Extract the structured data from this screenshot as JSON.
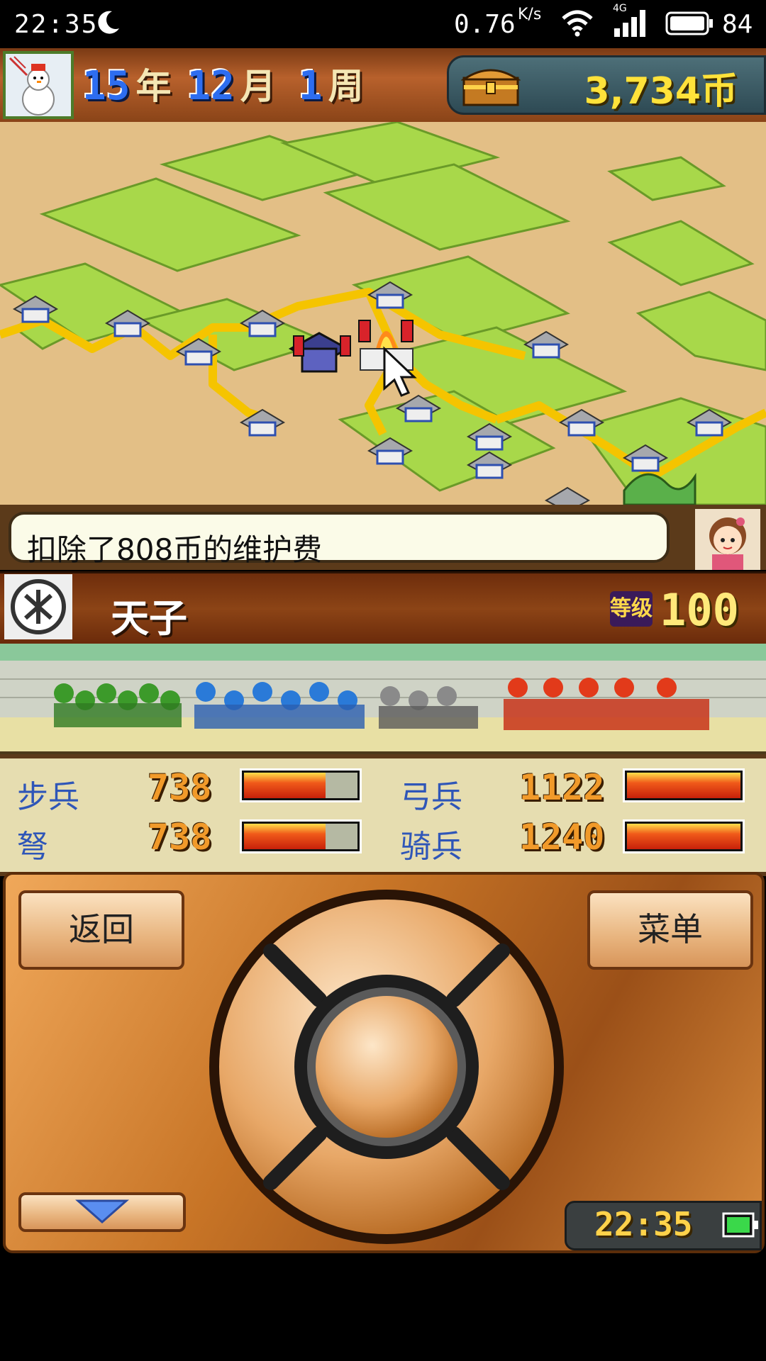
{
  "status_bar": {
    "time": "22:35",
    "speed": "0.76",
    "speed_unit": "K/s",
    "network": "4G",
    "battery": "84"
  },
  "header": {
    "year": "15",
    "year_unit": "年",
    "month": "12",
    "month_unit": "月",
    "week": "1",
    "week_unit": "周",
    "money": "3,734币"
  },
  "message": {
    "text": "扣除了808币的维护费"
  },
  "player": {
    "name": "天子",
    "level_label": "等级",
    "level": "100"
  },
  "stats": [
    {
      "label": "步兵",
      "value": "738",
      "fill": 0.72
    },
    {
      "label": "弓兵",
      "value": "1122",
      "fill": 1.0
    },
    {
      "label": "弩",
      "value": "738",
      "fill": 0.72
    },
    {
      "label": "骑兵",
      "value": "1240",
      "fill": 1.0
    }
  ],
  "controls": {
    "back_label": "返回",
    "menu_label": "菜单",
    "clock": "22:35"
  },
  "colors": {
    "accent_blue": "#2d6df0",
    "money_yellow": "#ffe23a",
    "stat_label_blue": "#2f56b8",
    "bar_red": "#f05a1a"
  }
}
